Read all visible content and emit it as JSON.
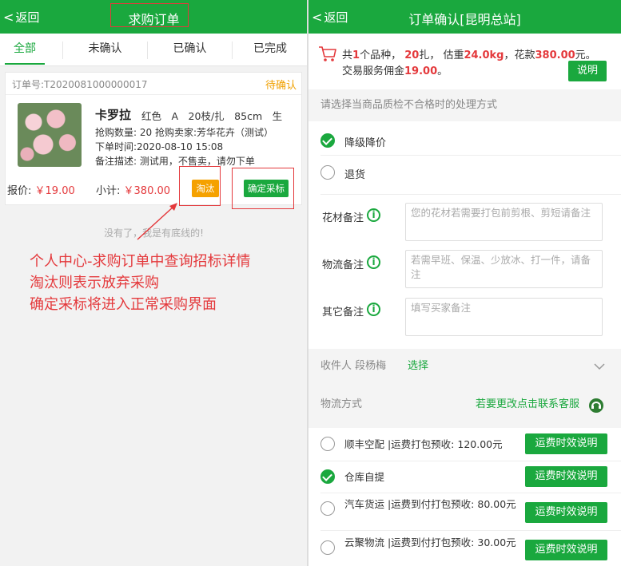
{
  "left": {
    "header": {
      "back_label": "返回",
      "title": "求购订单"
    },
    "tabs": [
      "全部",
      "未确认",
      "已确认",
      "已完成"
    ],
    "order": {
      "order_no": "订单号:T2020081000000017",
      "status": "待确认",
      "product_name": "卡罗拉",
      "product_spec": "红色　A　20枝/扎　85cm　生",
      "line1": "抢购数量: 20  抢购卖家:芳华花卉（测试）",
      "line2": "下单时间:2020-08-10 15:08",
      "line3": "备注描述: 测试用，不售卖，请勿下单",
      "quote_label": "报价:",
      "quote_value": "￥19.00",
      "subtotal_label": "小计:",
      "subtotal_value": "￥380.00",
      "reject_button": "淘汰",
      "confirm_button": "确定采标"
    },
    "no_more": "没有了，我是有底线的!",
    "annotation": [
      "个人中心-求购订单中查询招标详情",
      "淘汰则表示放弃采购",
      "确定采标将进入正常采购界面"
    ]
  },
  "right": {
    "header": {
      "back_label": "返回",
      "title": "订单确认[昆明总站]"
    },
    "summary": {
      "t1": "共",
      "n1": "1",
      "t2": "个品种，",
      "n2": "20",
      "t3": "扎，  估重",
      "n3": "24.0kg",
      "t4": "，花款",
      "n4": "380.00",
      "t5": "元。",
      "fee_text": "交易服务佣金",
      "fee_value": "19.00",
      "fee_end": "。",
      "explain_button": "说明"
    },
    "qc_header": "请选择当商品质检不合格时的处理方式",
    "qc_options": [
      {
        "label": "降级降价",
        "checked": true
      },
      {
        "label": "退货",
        "checked": false
      }
    ],
    "notes": [
      {
        "label": "花材备注",
        "placeholder": "您的花材若需要打包前剪根、剪短请备注"
      },
      {
        "label": "物流备注",
        "placeholder": "若需早班、保温、少放冰、打一件，请备注"
      },
      {
        "label": "其它备注",
        "placeholder": "填写买家备注"
      }
    ],
    "receiver": {
      "label": "收件人 段杨梅",
      "action": "选择"
    },
    "shipping_header": "物流方式",
    "contact_text": "若要更改点击联系客服",
    "shipping_options": [
      {
        "label": "顺丰空配 |运费打包预收: 120.00元",
        "checked": false,
        "button": "运费时效说明"
      },
      {
        "label": "仓库自提",
        "checked": true,
        "button": "运费时效说明"
      },
      {
        "label": "汽车货运 |运费到付打包预收: 80.00元",
        "checked": false,
        "button": "运费时效说明"
      },
      {
        "label": "云聚物流 |运费到付打包预收: 30.00元",
        "checked": false,
        "button": "运费时效说明"
      }
    ],
    "colors": {
      "brand_green": "#1aa83e",
      "price_red": "#e4393c",
      "pending_orange": "#f0a000"
    }
  }
}
